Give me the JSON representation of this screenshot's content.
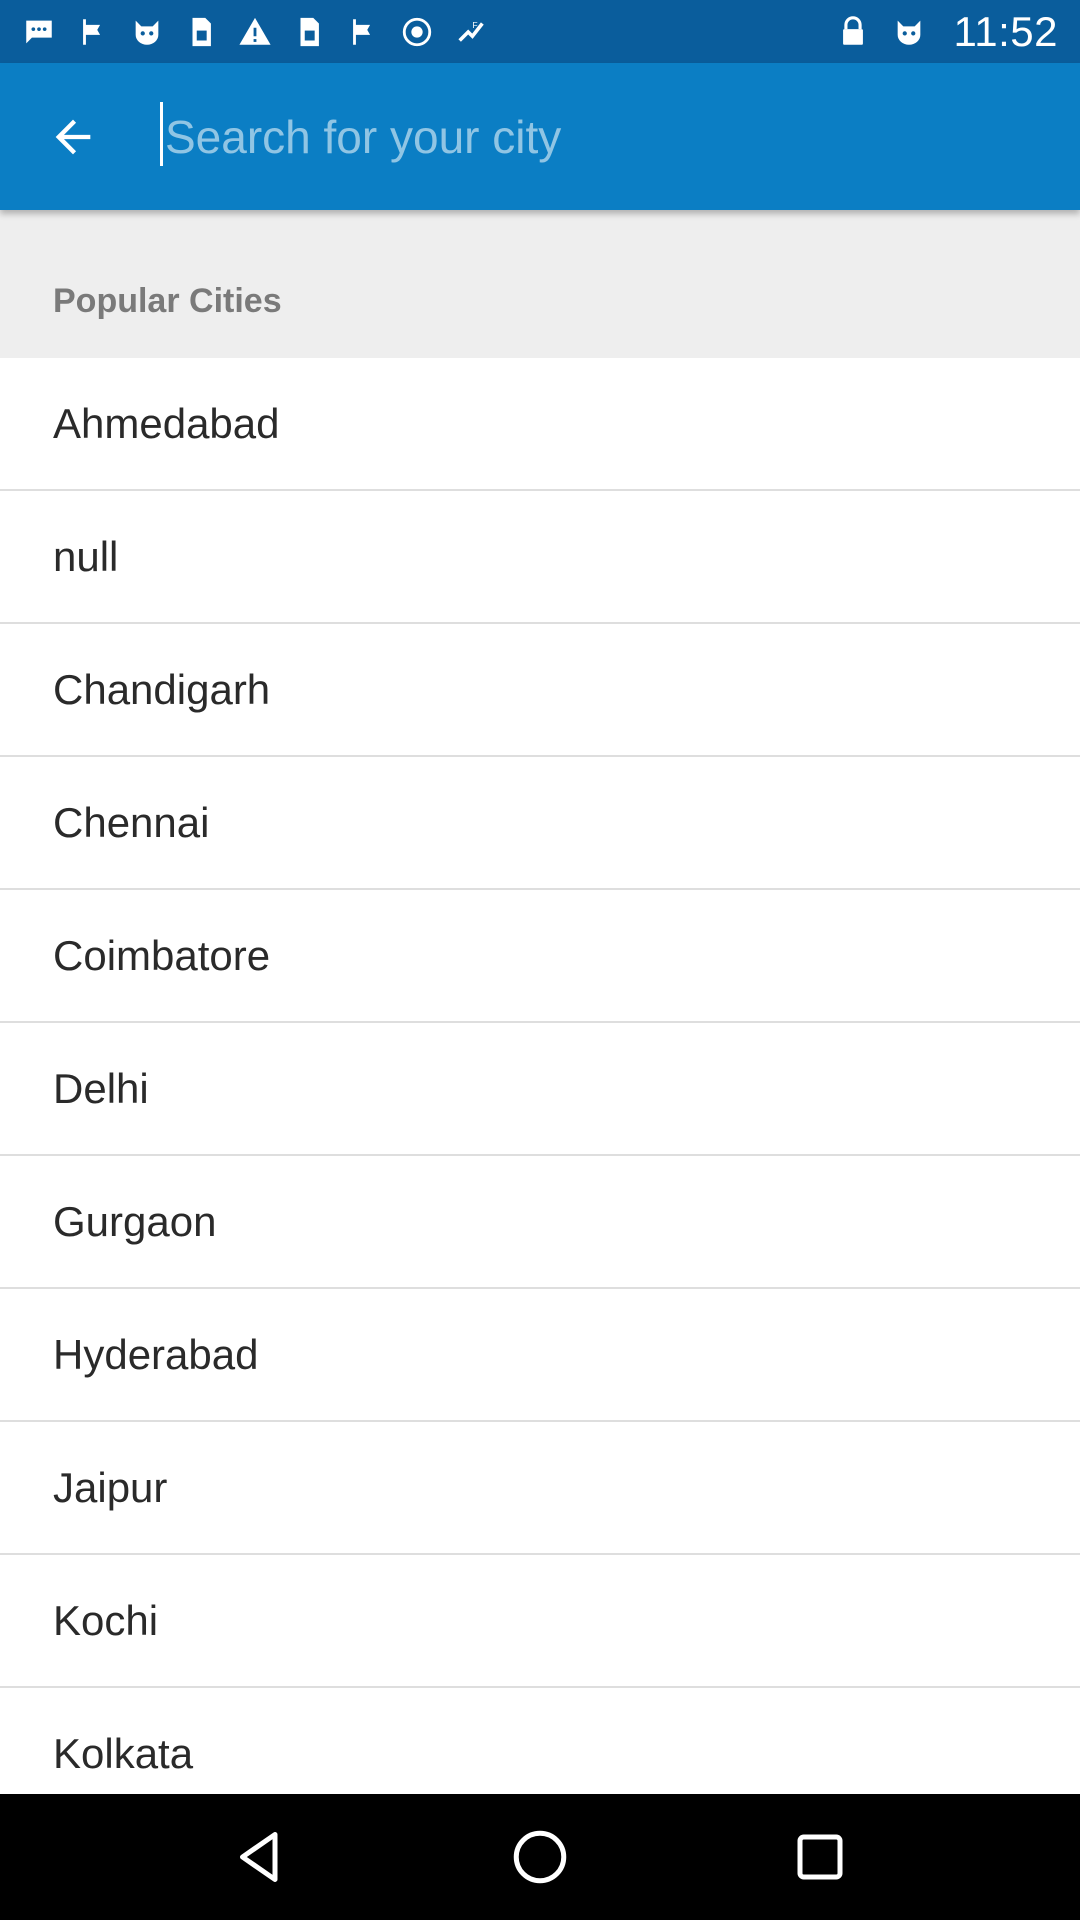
{
  "status_bar": {
    "time": "11:52",
    "left_icons": [
      "chat-icon",
      "flag-icon",
      "cat-icon",
      "sim-icon",
      "warning-icon",
      "sim-icon",
      "flag-icon",
      "circle-icon",
      "fake-gps-icon"
    ],
    "right_icons": [
      "lock-icon",
      "cat-icon"
    ]
  },
  "header": {
    "search_placeholder": "Search for your city",
    "search_value": ""
  },
  "section": {
    "title": "Popular Cities"
  },
  "cities": [
    "Ahmedabad",
    "null",
    "Chandigarh",
    "Chennai",
    "Coimbatore",
    "Delhi",
    "Gurgaon",
    "Hyderabad",
    "Jaipur",
    "Kochi",
    "Kolkata"
  ],
  "colors": {
    "status_bar": "#0a5d9c",
    "app_bar": "#0b7ec4",
    "section_bg": "#eeeeee",
    "divider": "#dedede"
  }
}
